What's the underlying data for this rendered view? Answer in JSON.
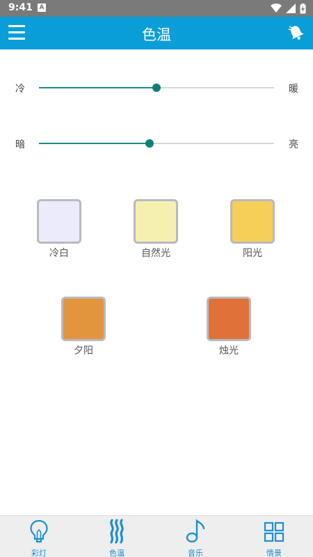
{
  "status_bar": {
    "time": "9:41",
    "notification_letter": "A"
  },
  "header": {
    "title": "色温",
    "menu_icon": "hamburger-menu-icon",
    "action_icon": "bell-icon"
  },
  "sliders": [
    {
      "id": "temperature",
      "left_label": "冷",
      "right_label": "暖",
      "value": 0.5
    },
    {
      "id": "brightness",
      "left_label": "暗",
      "right_label": "亮",
      "value": 0.47
    }
  ],
  "presets": [
    {
      "label": "冷白",
      "color": "#ebebfc"
    },
    {
      "label": "自然光",
      "color": "#f6f0b0"
    },
    {
      "label": "阳光",
      "color": "#f5cf57"
    },
    {
      "label": "夕阳",
      "color": "#e3953d"
    },
    {
      "label": "烛光",
      "color": "#df7139"
    }
  ],
  "nav": [
    {
      "label": "彩灯",
      "icon": "lightbulb-icon"
    },
    {
      "label": "色温",
      "icon": "heat-waves-icon",
      "active": true
    },
    {
      "label": "音乐",
      "icon": "music-note-icon"
    },
    {
      "label": "情景",
      "icon": "grid-scenes-icon"
    }
  ],
  "colors": {
    "accent": "#0a9ed8",
    "slider_active": "#1a8a84",
    "nav_icon": "#1c8fd0"
  }
}
